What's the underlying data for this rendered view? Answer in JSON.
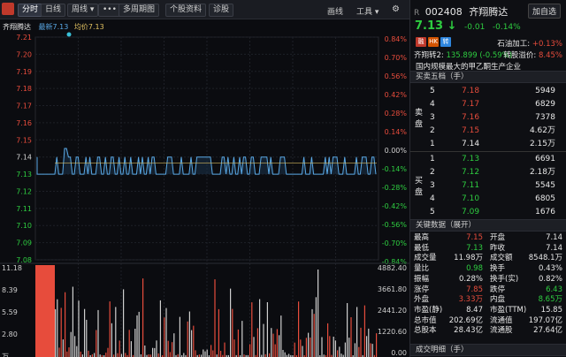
{
  "toolbar": {
    "tabs": [
      "分时",
      "日线",
      "周线 ▾",
      "•••",
      "多周期图",
      "个股资料",
      "诊股"
    ],
    "right": [
      "画线",
      "工具 ▾"
    ]
  },
  "chart": {
    "name": "齐翔腾达",
    "latest_label": "最新7.13",
    "avg_label": "均价7.13",
    "price_ticks": [
      "7.21",
      "7.20",
      "7.19",
      "7.18",
      "7.17",
      "7.16",
      "7.15",
      "7.14",
      "7.13",
      "7.12",
      "7.11",
      "7.10",
      "7.09",
      "7.08"
    ],
    "pct_ticks": [
      "0.84%",
      "0.70%",
      "0.56%",
      "0.42%",
      "0.28%",
      "0.14%",
      "0.00%",
      "-0.14%",
      "-0.28%",
      "-0.42%",
      "-0.56%",
      "-0.70%",
      "-0.84%"
    ],
    "vol_ticks_left": [
      "11.18",
      "8.39",
      "5.59",
      "2.80",
      "万"
    ],
    "vol_ticks_right": [
      "4882.40",
      "3661.80",
      "2441.20",
      "1220.60",
      "0.00"
    ]
  },
  "panel": {
    "market_tag": "R",
    "code": "002408",
    "name": "齐翔腾达",
    "add_button": "加自选",
    "price": "7.13",
    "arrow": "↓",
    "change": "-0.01",
    "change_pct": "-0.14%",
    "tags": [
      "融",
      "HK",
      "转"
    ],
    "tag_colors": [
      "#c0392b",
      "#d35400",
      "#2e86de"
    ],
    "petro_label": "石油加工:",
    "petro_value": "+0.13%",
    "bond_label": "齐翔转2:",
    "bond_value": "135.899",
    "bond_change": "(-0.59%)",
    "premium_label": "转股溢价:",
    "premium_value": "8.45%",
    "description": "国内规模最大的甲乙酮生产企业",
    "orderbook_title": "买卖五档（手）",
    "sell_label": [
      "卖",
      "盘"
    ],
    "buy_label": [
      "买",
      "盘"
    ],
    "asks": [
      {
        "level": "5",
        "price": "7.18",
        "volume": "5949"
      },
      {
        "level": "4",
        "price": "7.17",
        "volume": "6829"
      },
      {
        "level": "3",
        "price": "7.16",
        "volume": "7378"
      },
      {
        "level": "2",
        "price": "7.15",
        "volume": "4.62万"
      },
      {
        "level": "1",
        "price": "7.14",
        "volume": "2.15万"
      }
    ],
    "bids": [
      {
        "level": "1",
        "price": "7.13",
        "volume": "6691"
      },
      {
        "level": "2",
        "price": "7.12",
        "volume": "2.18万"
      },
      {
        "level": "3",
        "price": "7.11",
        "volume": "5545"
      },
      {
        "level": "4",
        "price": "7.10",
        "volume": "6805"
      },
      {
        "level": "5",
        "price": "7.09",
        "volume": "1676"
      }
    ],
    "keydata_title": "关键数据（展开）",
    "stats": [
      {
        "l1": "最高",
        "v1": "7.15",
        "c1": "red",
        "l2": "开盘",
        "v2": "7.14",
        "c2": "white"
      },
      {
        "l1": "最低",
        "v1": "7.13",
        "c1": "green",
        "l2": "昨收",
        "v2": "7.14",
        "c2": "white"
      },
      {
        "l1": "成交量",
        "v1": "11.98万",
        "c1": "white",
        "l2": "成交额",
        "v2": "8548.1万",
        "c2": "white"
      },
      {
        "l1": "量比",
        "v1": "0.98",
        "c1": "green",
        "l2": "换手",
        "v2": "0.43%",
        "c2": "white"
      },
      {
        "l1": "振幅",
        "v1": "0.28%",
        "c1": "white",
        "l2": "换手(实)",
        "v2": "0.82%",
        "c2": "white"
      },
      {
        "l1": "涨停",
        "v1": "7.85",
        "c1": "red",
        "l2": "跌停",
        "v2": "6.43",
        "c2": "green"
      },
      {
        "l1": "外盘",
        "v1": "3.33万",
        "c1": "red",
        "l2": "内盘",
        "v2": "8.65万",
        "c2": "green"
      },
      {
        "l1": "市盈(静)",
        "v1": "8.47",
        "c1": "white",
        "l2": "市盈(TTM)",
        "v2": "15.85",
        "c2": "white"
      },
      {
        "l1": "总市值",
        "v1": "202.69亿",
        "c1": "white",
        "l2": "流通值",
        "v2": "197.07亿",
        "c2": "white"
      },
      {
        "l1": "总股本",
        "v1": "28.43亿",
        "c1": "white",
        "l2": "流通股",
        "v2": "27.64亿",
        "c2": "white"
      }
    ],
    "trades_title": "成交明细（手）"
  },
  "colors": {
    "up": "#e74c3c",
    "down": "#2ecc40",
    "price_line": "#5aa9e6",
    "avg_line": "#e0c060"
  }
}
